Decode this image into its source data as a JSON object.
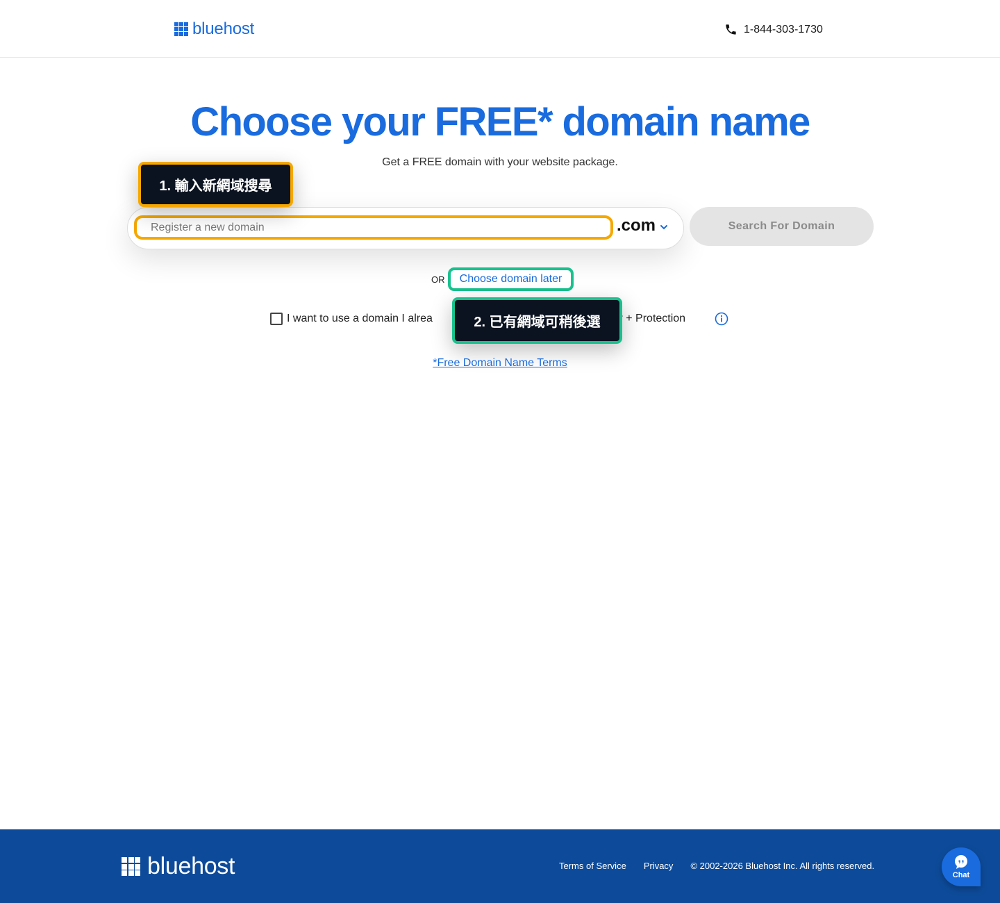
{
  "header": {
    "logo_text": "bluehost",
    "phone": "1-844-303-1730"
  },
  "hero": {
    "title": "Choose your FREE* domain name",
    "subtitle": "Get a FREE domain with your website package."
  },
  "search": {
    "placeholder": "Register a new domain",
    "tld": ".com",
    "button_label": "Search For Domain"
  },
  "annotations": {
    "step1": "1. 輸入新網域搜尋",
    "step2": "2. 已有網域可稍後選"
  },
  "alternatives": {
    "or_label": "OR",
    "later_link": "Choose domain later",
    "checkbox_text_left": "I want to use a domain I alrea",
    "checkbox_text_right": "acy + Protection"
  },
  "terms_link": "*Free Domain Name Terms",
  "footer": {
    "logo_text": "bluehost",
    "links": [
      "Terms of Service",
      "Privacy",
      "© 2002-2026 Bluehost Inc. All rights reserved."
    ],
    "chat_label": "Chat"
  },
  "colors": {
    "brand_blue": "#196bde",
    "footer_blue": "#0d4b9a",
    "annotation_orange": "#f5a800",
    "annotation_green": "#19c28d"
  },
  "icons": [
    "grid-logo-icon",
    "phone-icon",
    "chevron-down-icon",
    "info-icon",
    "chat-icon"
  ]
}
